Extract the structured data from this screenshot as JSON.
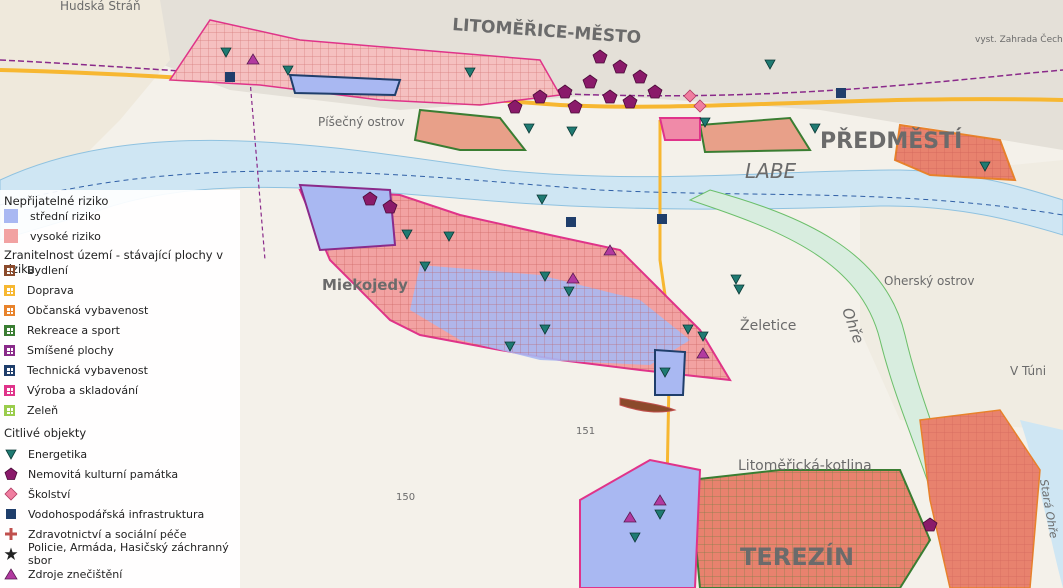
{
  "map": {
    "places": [
      "LITOMĚŘICE-MĚSTO",
      "PŘEDMĚSTÍ",
      "LABE",
      "Píšečný ostrov",
      "Miekojedy",
      "Želetice",
      "Oherský ostrov",
      "Litoměřická-kotlina",
      "TEREZÍN",
      "Ohře",
      "V Túni",
      "Hudská Stráň",
      "Stará Ohře",
      "vyst. Zahrada Čech",
      "151",
      "150"
    ]
  },
  "legend": {
    "risk_title": "Nepřijatelné riziko",
    "risk_items": [
      {
        "label": "střední riziko",
        "color": "#a9b8f2"
      },
      {
        "label": "vysoké riziko",
        "color": "#f2a2a2"
      }
    ],
    "zone_title": "Zranitelnost území - stávající plochy v riziku",
    "zone_items": [
      {
        "label": "Bydlení",
        "color": "#8b4a2b"
      },
      {
        "label": "Doprava",
        "color": "#f7b731"
      },
      {
        "label": "Občanská vybavenost",
        "color": "#e8822b"
      },
      {
        "label": "Rekreace a sport",
        "color": "#3a7d32"
      },
      {
        "label": "Smíšené plochy",
        "color": "#8a2a8a"
      },
      {
        "label": "Technická vybavenost",
        "color": "#1f3e6b"
      },
      {
        "label": "Výroba a skladování",
        "color": "#e0338a"
      },
      {
        "label": "Zeleň",
        "color": "#9acd4c"
      }
    ],
    "sensitive_title": "Citlivé objekty",
    "sensitive_items": [
      {
        "label": "Energetika",
        "icon": "teal-triangle-icon"
      },
      {
        "label": "Nemovitá kulturní památka",
        "icon": "pentagon-icon"
      },
      {
        "label": "Školství",
        "icon": "diamond-icon"
      },
      {
        "label": "Vodohospodářská infrastruktura",
        "icon": "square-icon"
      },
      {
        "label": "Zdravotnictví a sociální péče",
        "icon": "cross-icon"
      },
      {
        "label": "Policie, Armáda, Hasičský záchranný sbor",
        "icon": "star-icon"
      },
      {
        "label": "Zdroje znečištění",
        "icon": "magenta-triangle-icon"
      }
    ]
  }
}
